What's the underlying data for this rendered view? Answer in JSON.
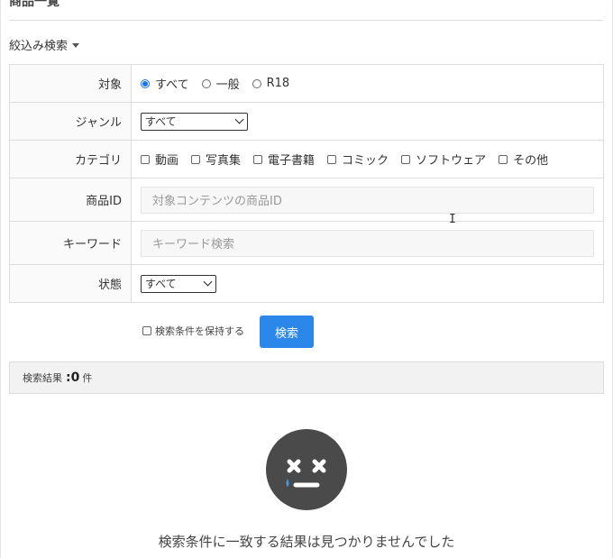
{
  "page": {
    "title": "商品一覧"
  },
  "filter": {
    "toggle_label": "絞込み検索"
  },
  "rows": {
    "target": {
      "label": "対象",
      "options": [
        "すべて",
        "一般",
        "R18"
      ],
      "selected": "すべて"
    },
    "genre": {
      "label": "ジャンル",
      "value": "すべて"
    },
    "category": {
      "label": "カテゴリ",
      "options": [
        "動画",
        "写真集",
        "電子書籍",
        "コミック",
        "ソフトウェア",
        "その他"
      ]
    },
    "product_id": {
      "label": "商品ID",
      "placeholder": "対象コンテンツの商品ID"
    },
    "keyword": {
      "label": "キーワード",
      "placeholder": "キーワード検索"
    },
    "status": {
      "label": "状態",
      "value": "すべて"
    }
  },
  "actions": {
    "keep_label": "検索条件を保持する",
    "search_label": "検索"
  },
  "results": {
    "label": "検索結果",
    "prefix": ":",
    "count": "0",
    "unit": "件",
    "empty_message": "検索条件に一致する結果は見つかりませんでした"
  },
  "icons": {
    "empty": "sad-face-icon",
    "cursor": "text-cursor-icon"
  },
  "colors": {
    "accent": "#2b88ea",
    "icon": "#4a4a4a"
  }
}
